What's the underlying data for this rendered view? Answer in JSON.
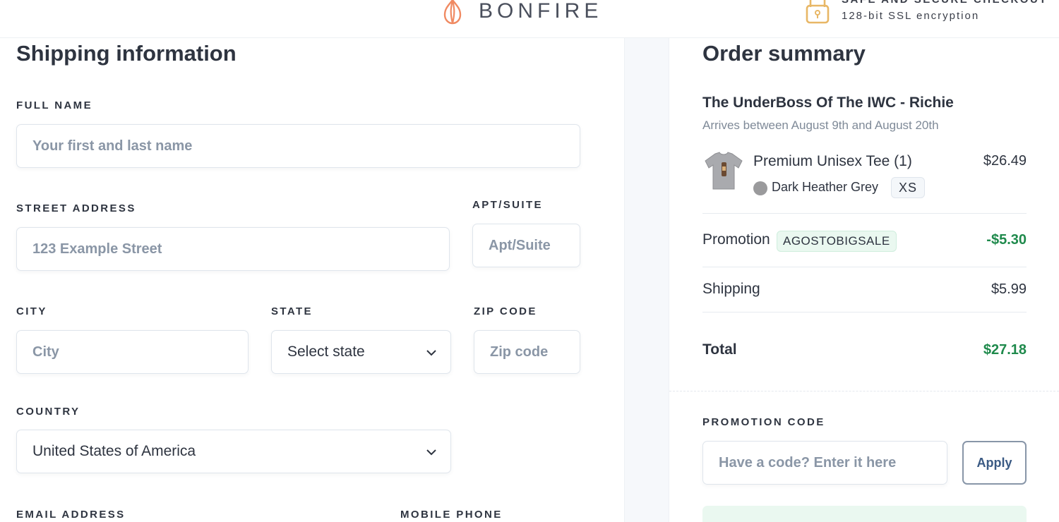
{
  "header": {
    "brand": "BONFIRE",
    "secure_title": "SAFE AND SECURE CHECKOUT",
    "secure_subtitle": "128-bit SSL encryption",
    "brand_color": "#f08a62"
  },
  "shipping": {
    "title": "Shipping information",
    "full_name": {
      "label": "FULL NAME",
      "placeholder": "Your first and last name",
      "value": ""
    },
    "street": {
      "label": "STREET ADDRESS",
      "placeholder": "123 Example Street",
      "value": ""
    },
    "apt": {
      "label": "APT/SUITE",
      "placeholder": "Apt/Suite",
      "value": ""
    },
    "city": {
      "label": "CITY",
      "placeholder": "City",
      "value": ""
    },
    "state": {
      "label": "STATE",
      "selected": "Select state"
    },
    "zip": {
      "label": "ZIP CODE",
      "placeholder": "Zip code",
      "value": ""
    },
    "country": {
      "label": "COUNTRY",
      "selected": "United States of America"
    },
    "email_label": "EMAIL ADDRESS",
    "phone_label": "MOBILE PHONE"
  },
  "summary": {
    "title": "Order summary",
    "product_title": "The UnderBoss Of The IWC - Richie",
    "arrives": "Arrives between August 9th and August 20th",
    "item": {
      "name": "Premium Unisex Tee (1)",
      "price": "$26.49",
      "color_name": "Dark Heather Grey",
      "color_hex": "#9a9a9c",
      "size": "XS",
      "image_icon": "tshirt-thumbnail"
    },
    "promotion": {
      "label": "Promotion",
      "code": "AGOSTOBIGSALE",
      "amount": "-$5.30"
    },
    "shipping": {
      "label": "Shipping",
      "amount": "$5.99"
    },
    "total": {
      "label": "Total",
      "amount": "$27.18"
    },
    "promo_code": {
      "label": "PROMOTION CODE",
      "placeholder": "Have a code? Enter it here",
      "value": "",
      "apply_label": "Apply"
    },
    "accent_green": "#1f8a4c"
  }
}
